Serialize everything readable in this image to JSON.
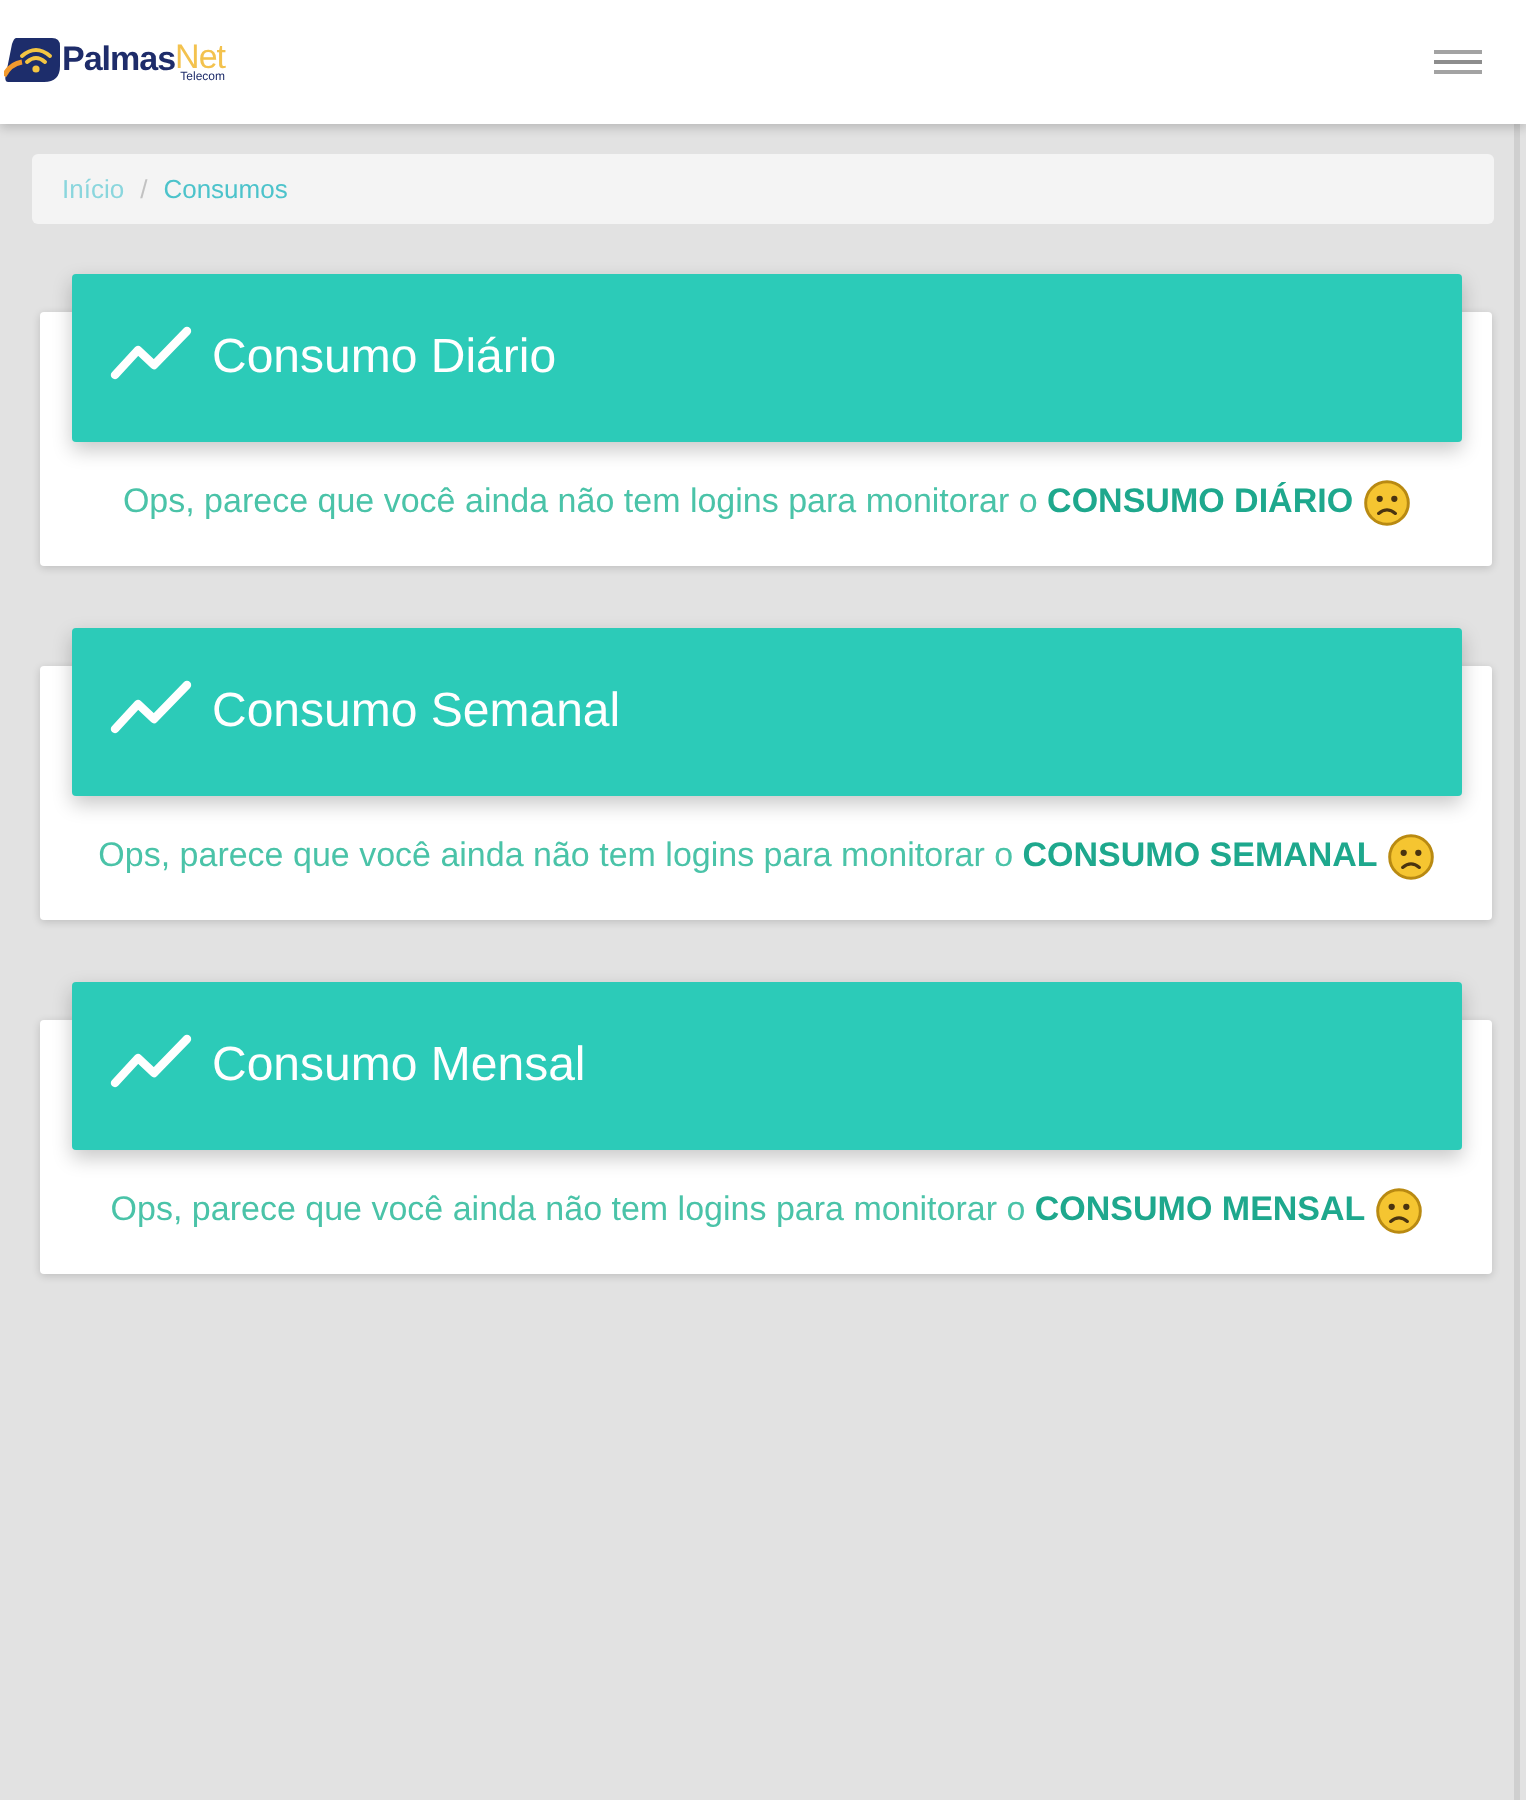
{
  "navbar": {
    "logo": {
      "name": "Palmas",
      "accent": "Net",
      "tagline": "Telecom"
    }
  },
  "breadcrumb": {
    "separator": "/",
    "items": [
      {
        "label": "Início",
        "selected": false
      },
      {
        "label": "Consumos",
        "selected": true
      }
    ]
  },
  "cards": [
    {
      "title": "Consumo Diário",
      "message": "Ops, parece que você ainda não tem logins para monitorar o **CONSUMO DIÁRIO**"
    },
    {
      "title": "Consumo Semanal",
      "message": "Ops, parece que você ainda não tem logins para monitorar o **CONSUMO SEMANAL**"
    },
    {
      "title": "Consumo Mensal",
      "message": "Ops, parece que você ainda não tem logins para monitorar o **CONSUMO MENSAL**"
    }
  ]
}
